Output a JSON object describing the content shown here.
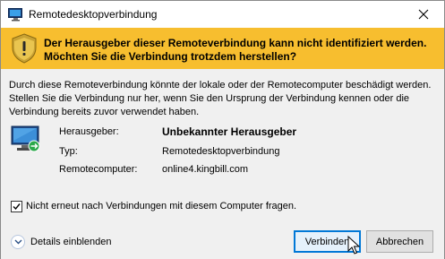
{
  "window": {
    "title": "Remotedesktopverbindung"
  },
  "banner": {
    "message": "Der Herausgeber dieser Remoteverbindung kann nicht identifiziert werden. Möchten Sie die Verbindung trotzdem herstellen?",
    "color": "#f7be2f"
  },
  "content": {
    "description": "Durch diese Remoteverbindung könnte der lokale oder der Remotecomputer beschädigt werden. Stellen Sie die Verbindung nur her, wenn Sie den Ursprung der Verbindung kennen oder die Verbindung bereits zuvor verwendet haben.",
    "rows": [
      {
        "label": "Herausgeber:",
        "value": "Unbekannter Herausgeber"
      },
      {
        "label": "Typ:",
        "value": "Remotedesktopverbindung"
      },
      {
        "label": "Remotecomputer:",
        "value": "online4.kingbill.com"
      }
    ]
  },
  "checkbox": {
    "label": "Nicht erneut nach Verbindungen mit diesem Computer fragen.",
    "checked": true
  },
  "footer": {
    "details_label": "Details einblenden",
    "connect_label": "Verbinden",
    "cancel_label": "Abbrechen"
  },
  "icons": {
    "title": "remote-desktop-icon",
    "banner": "warning-shield-icon",
    "content": "remote-computer-icon",
    "details": "chevron-down-icon",
    "close": "close-icon"
  }
}
